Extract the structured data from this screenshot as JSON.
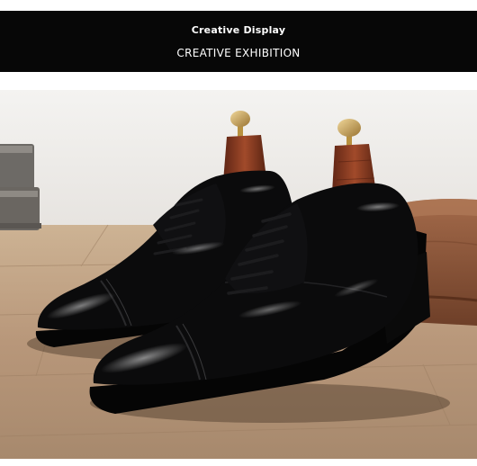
{
  "header": {
    "title": "Creative Display",
    "subtitle": "CREATIVE EXHIBITION"
  },
  "photo": {
    "subject": "black-patent-leather-cap-toe-oxford-shoes",
    "colors": {
      "header_bg": "#070707",
      "wall": "#f0efed",
      "floor": "#b89a7a",
      "shoe": "#0b0b0c",
      "shoe_tree_wood": "#8a3a22",
      "shoe_tree_knob": "#c9a35a",
      "leather_bag": "#8e5a3e",
      "books": "#7a7670"
    }
  }
}
